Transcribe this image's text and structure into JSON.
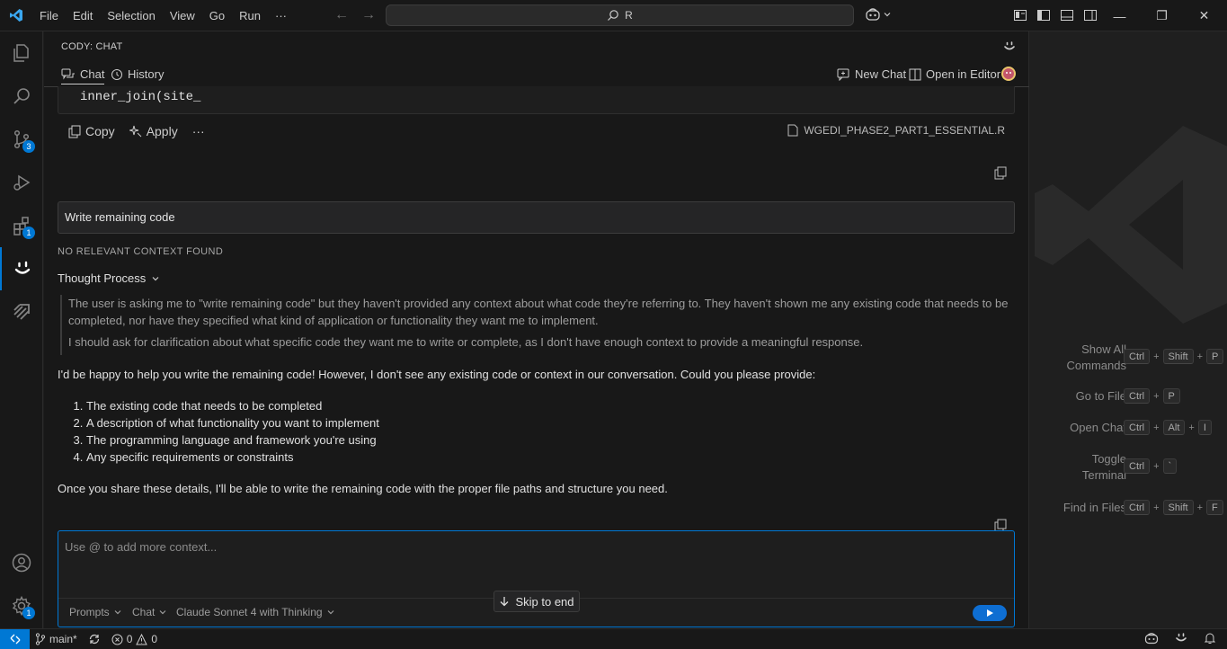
{
  "titlebar": {
    "menu": [
      "File",
      "Edit",
      "Selection",
      "View",
      "Go",
      "Run",
      "···"
    ],
    "search_text": "R"
  },
  "activity_bar": {
    "source_control_badge": "3",
    "extensions_badge": "1",
    "settings_badge": "1"
  },
  "panel": {
    "title": "CODY: CHAT",
    "tabs": {
      "chat": "Chat",
      "history": "History"
    },
    "actions": {
      "new_chat": "New Chat",
      "open_in_editor": "Open in Editor"
    },
    "code_line": "inner_join(site_",
    "code_actions": {
      "copy": "Copy",
      "apply": "Apply",
      "more": "···"
    },
    "file_ref": "WGEDI_PHASE2_PART1_ESSENTIAL.R",
    "user_message": "Write remaining code",
    "no_context": "NO RELEVANT CONTEXT FOUND",
    "thought_label": "Thought Process",
    "thought": [
      "The user is asking me to \"write remaining code\" but they haven't provided any context about what code they're referring to. They haven't shown me any existing code that needs to be completed, nor have they specified what kind of application or functionality they want me to implement.",
      "I should ask for clarification about what specific code they want me to write or complete, as I don't have enough context to provide a meaningful response."
    ],
    "answer_intro": "I'd be happy to help you write the remaining code! However, I don't see any existing code or context in our conversation. Could you please provide:",
    "answer_list": [
      "The existing code that needs to be completed",
      "A description of what functionality you want to implement",
      "The programming language and framework you're using",
      "Any specific requirements or constraints"
    ],
    "answer_outro": "Once you share these details, I'll be able to write the remaining code with the proper file paths and structure you need.",
    "input": {
      "placeholder": "Use @ to add more context...",
      "value": ""
    },
    "footer": {
      "prompts": "Prompts",
      "mode": "Chat",
      "model": "Claude Sonnet 4 with Thinking"
    },
    "skip_to_end": "Skip to end"
  },
  "editor": {
    "shortcuts": [
      {
        "label_lines": [
          "Show All",
          "Commands"
        ],
        "keys": [
          "Ctrl",
          "Shift",
          "P"
        ]
      },
      {
        "label_lines": [
          "Go to File"
        ],
        "keys": [
          "Ctrl",
          "P"
        ]
      },
      {
        "label_lines": [
          "Open Chat"
        ],
        "keys": [
          "Ctrl",
          "Alt",
          "I"
        ]
      },
      {
        "label_lines": [
          "Toggle",
          "Terminal"
        ],
        "keys": [
          "Ctrl",
          "`"
        ]
      },
      {
        "label_lines": [
          "Find in Files"
        ],
        "keys": [
          "Ctrl",
          "Shift",
          "F"
        ]
      }
    ]
  },
  "statusbar": {
    "branch": "main*",
    "errors": "0",
    "warnings": "0"
  },
  "colors": {
    "accent": "#0078d4",
    "background": "#1f1f1f",
    "sidebar": "#181818"
  }
}
